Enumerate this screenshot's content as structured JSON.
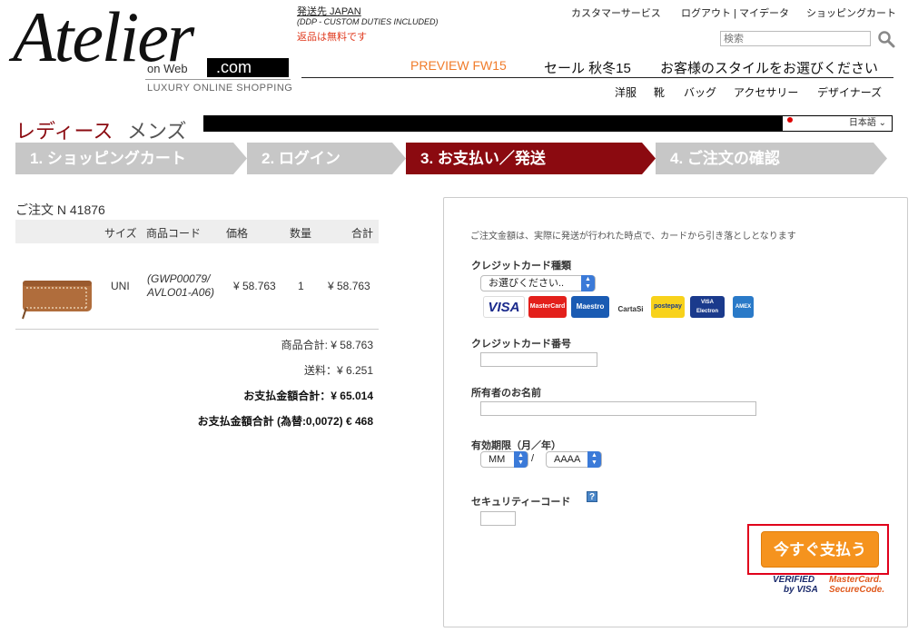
{
  "header": {
    "logo_script": "Atelier",
    "logo_onweb": "on Web",
    "logo_com": ".com",
    "logo_tagline": "LUXURY ONLINE SHOPPING",
    "ship_to": "発送先 JAPAN",
    "ship_ddp": "(DDP - CUSTOM DUTIES INCLUDED)",
    "ship_returns": "返品は無料です",
    "links": [
      "カスタマーサービス",
      "ログアウト | マイデータ",
      "ショッピングカート"
    ],
    "search_placeholder": "検索",
    "nav_main": [
      "PREVIEW FW15",
      "セール 秋冬15",
      "お客様のスタイルをお選びください"
    ],
    "nav_sub": [
      "洋服",
      "靴",
      "バッグ",
      "アクセサリー",
      "デザイナーズ"
    ],
    "gender_women": "レディース",
    "gender_men": "メンズ",
    "language": "日本語"
  },
  "steps": [
    {
      "label": "1. ショッピングカート",
      "active": false
    },
    {
      "label": "2. ログイン",
      "active": false
    },
    {
      "label": "3. お支払い／発送",
      "active": true
    },
    {
      "label": "4. ご注文の確認",
      "active": false
    }
  ],
  "order": {
    "title": "ご注文 N 41876",
    "columns": [
      "サイズ",
      "商品コード",
      "価格",
      "数量",
      "合計"
    ],
    "item": {
      "size": "UNI",
      "code_line1": "(GWP00079/",
      "code_line2": "AVLO01-A06)",
      "price": "¥ 58.763",
      "qty": "1",
      "total": "¥ 58.763"
    },
    "subtotal": "商品合計: ¥ 58.763",
    "shipping": "送料：¥ 6.251",
    "grand_total": "お支払金額合計：¥ 65.014",
    "grand_total_eur": "お支払金額合計 (為替:0,0072) € 468"
  },
  "payment": {
    "note": "ご注文金額は、実際に発送が行われた時点で、カードから引き落としとなります",
    "card_type_label": "クレジットカード種類",
    "card_type_value": "お選びください..",
    "cards": [
      "VISA",
      "MasterCard",
      "Maestro",
      "CartaSi",
      "postepay",
      "VISA Electron",
      "AMEX"
    ],
    "card_number_label": "クレジットカード番号",
    "holder_label": "所有者のお名前",
    "expiry_label": "有効期限（月／年）",
    "month_value": "MM",
    "year_value": "AAAA",
    "expiry_sep": "/",
    "cvv_label": "セキュリティーコード",
    "help": "?",
    "pay_button": "今すぐ支払う",
    "verified_by_visa_1": "VERIFIED",
    "verified_by_visa_2": "by VISA",
    "mastercard_secure_1": "MasterCard.",
    "mastercard_secure_2": "SecureCode."
  }
}
